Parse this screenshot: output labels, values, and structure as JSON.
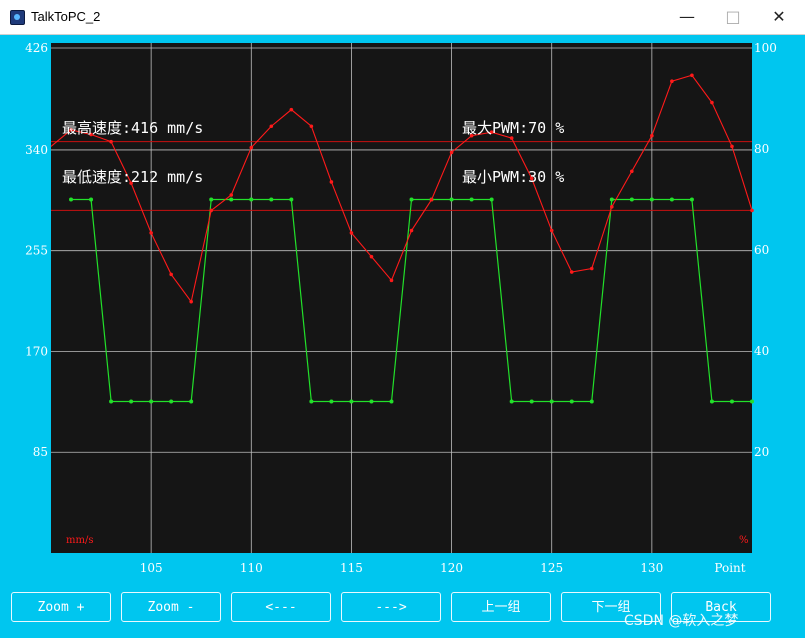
{
  "window": {
    "title": "TalkToPC_2"
  },
  "colors": {
    "client_bg": "#00c6ef",
    "plot_bg": "#151515",
    "speed": "#ff1a1a",
    "pwm": "#22e02a",
    "grid": "#bfbfbf"
  },
  "icons": {
    "app": "app-icon",
    "minimize": "minimize-icon",
    "maximize": "maximize-icon",
    "close": "close-icon"
  },
  "overlay": {
    "max_speed": "最高速度:416 mm/s",
    "min_speed": "最低速度:212 mm/s",
    "max_pwm": "最大PWM:70 %",
    "min_pwm": "最小PWM:30 %"
  },
  "chart_data": {
    "type": "line",
    "x": [
      101,
      102,
      103,
      104,
      105,
      106,
      107,
      108,
      109,
      110,
      111,
      112,
      113,
      114,
      115,
      116,
      117,
      118,
      119,
      120,
      121,
      122,
      123,
      124,
      125,
      126,
      127,
      128,
      129,
      130,
      131,
      132,
      133,
      134,
      135
    ],
    "xlim": [
      100,
      135
    ],
    "xticks": [
      105,
      110,
      115,
      120,
      125,
      130
    ],
    "xlabel": "Point",
    "ylim_left": [
      0,
      426
    ],
    "yticks_left": [
      85,
      170,
      255,
      340,
      426
    ],
    "ylabel_left": "mm/s",
    "ylim_right": [
      0,
      100
    ],
    "yticks_right": [
      20,
      40,
      60,
      80,
      100
    ],
    "ylabel_right": "%",
    "grid": true,
    "series": [
      {
        "axis": "left",
        "values": [
          357,
          353,
          347,
          312,
          270,
          235,
          212,
          289,
          302,
          342,
          360,
          374,
          360,
          313,
          270,
          250,
          230,
          272,
          298,
          338,
          352,
          355,
          350,
          316,
          272,
          237,
          240,
          292,
          322,
          352,
          398,
          403,
          380,
          343,
          289
        ]
      },
      {
        "axis": "right",
        "values": [
          70,
          70,
          30,
          30,
          30,
          30,
          30,
          70,
          70,
          70,
          70,
          70,
          30,
          30,
          30,
          30,
          30,
          70,
          70,
          70,
          70,
          70,
          30,
          30,
          30,
          30,
          30,
          70,
          70,
          70,
          70,
          70,
          30,
          30,
          30
        ]
      }
    ],
    "hlines": [
      {
        "axis": "left",
        "value": 347
      },
      {
        "axis": "left",
        "value": 289
      }
    ]
  },
  "buttons": {
    "zoom_in": "Zoom +",
    "zoom_out": "Zoom -",
    "prev": "<---",
    "next": "--->",
    "prev_group": "上一组",
    "next_group": "下一组",
    "back": "Back"
  },
  "watermark": "CSDN @软入之梦"
}
